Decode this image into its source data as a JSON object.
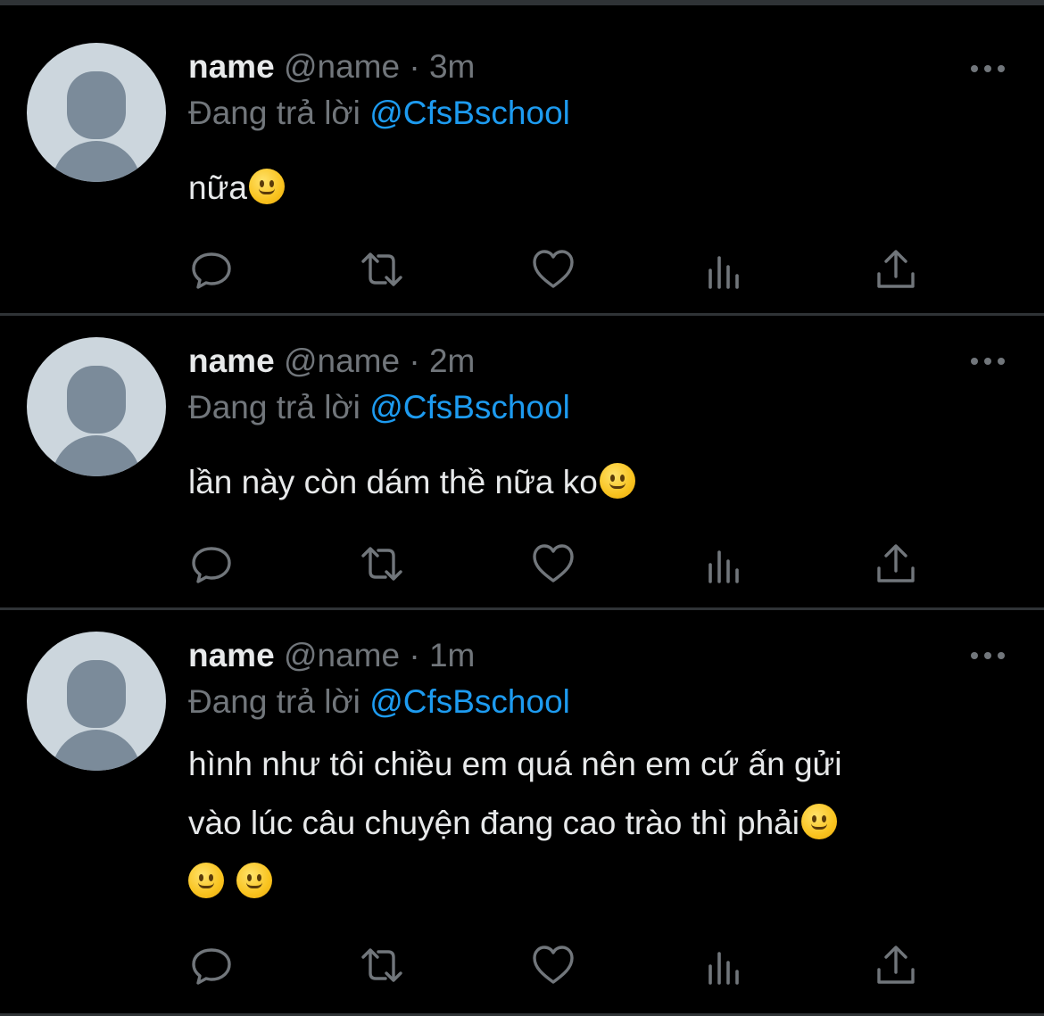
{
  "tweets": [
    {
      "name": "name",
      "handle": "@name",
      "separator": "·",
      "time": "3m",
      "reply_prefix": "Đang trả lời",
      "reply_to": "@CfsBschool",
      "text_lines": [
        "nữa"
      ],
      "emoji_after_line": [
        1
      ],
      "extra_emoji_line": 0
    },
    {
      "name": "name",
      "handle": "@name",
      "separator": "·",
      "time": "2m",
      "reply_prefix": "Đang trả lời",
      "reply_to": "@CfsBschool",
      "text_lines": [
        "lần này còn dám thề nữa ko"
      ],
      "emoji_after_line": [
        1
      ],
      "extra_emoji_line": 0
    },
    {
      "name": "name",
      "handle": "@name",
      "separator": "·",
      "time": "1m",
      "reply_prefix": "Đang trả lời",
      "reply_to": "@CfsBschool",
      "text_lines": [
        "hình như tôi chiều em quá nên em cứ ấn gửi",
        "vào lúc câu chuyện đang cao trào thì phải"
      ],
      "emoji_after_line": [
        0,
        1
      ],
      "extra_emoji_line": 2
    }
  ],
  "emoji": "slightly-smiling-face",
  "actions": [
    "reply-icon",
    "retweet-icon",
    "like-icon",
    "analytics-icon",
    "share-icon"
  ],
  "colors": {
    "background": "#000000",
    "text": "#e7e9ea",
    "secondary": "#71767b",
    "link": "#1d9bf0",
    "divider": "#2f3336",
    "avatar_bg": "#ccd6dd",
    "avatar_fg": "#7b8b9a"
  }
}
